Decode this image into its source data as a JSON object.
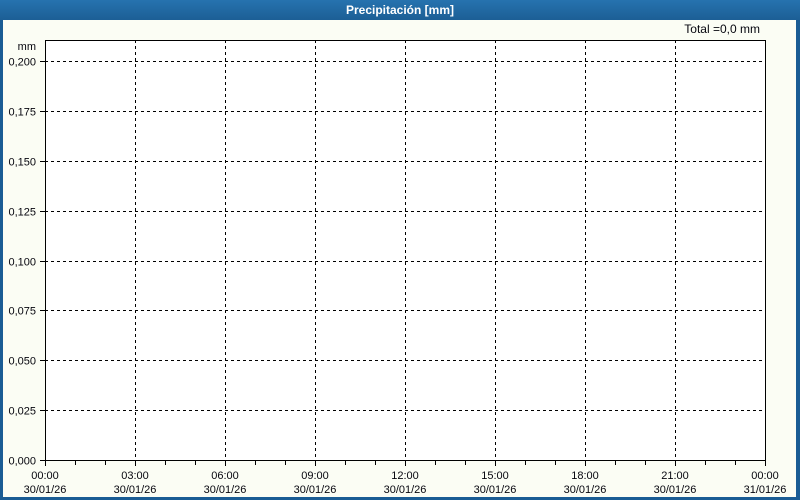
{
  "window": {
    "title": "Precipitación [mm]"
  },
  "header": {
    "total_label": "Total =0,0 mm"
  },
  "chart_data": {
    "type": "line",
    "title": "Precipitación [mm]",
    "ylabel": "mm",
    "xlabel": "",
    "ylim": [
      0,
      0.21
    ],
    "y_tick_step": 0.025,
    "y_ticks": [
      "0,200",
      "0,175",
      "0,150",
      "0,125",
      "0,100",
      "0,075",
      "0,050",
      "0,025",
      "0,000"
    ],
    "x_ticks": [
      {
        "time": "00:00",
        "date": "30/01/26"
      },
      {
        "time": "03:00",
        "date": "30/01/26"
      },
      {
        "time": "06:00",
        "date": "30/01/26"
      },
      {
        "time": "09:00",
        "date": "30/01/26"
      },
      {
        "time": "12:00",
        "date": "30/01/26"
      },
      {
        "time": "15:00",
        "date": "30/01/26"
      },
      {
        "time": "18:00",
        "date": "30/01/26"
      },
      {
        "time": "21:00",
        "date": "30/01/26"
      },
      {
        "time": "00:00",
        "date": "31/01/26"
      }
    ],
    "x_minor_tick_hours": 1,
    "x_major_tick_hours": 3,
    "x_span_hours": 24,
    "grid": true,
    "legend": "none",
    "series": [
      {
        "name": "Precipitación",
        "values": []
      }
    ],
    "total": "0,0 mm",
    "colors": {
      "titlebar": "#1F6499",
      "frame": "#1A5C94",
      "outer_bg": "#FBFDF4",
      "plot_bg": "#FFFFFF",
      "grid": "#000000",
      "axis": "#000000",
      "text": "#06060E",
      "title_text": "#FFFFFF"
    }
  }
}
